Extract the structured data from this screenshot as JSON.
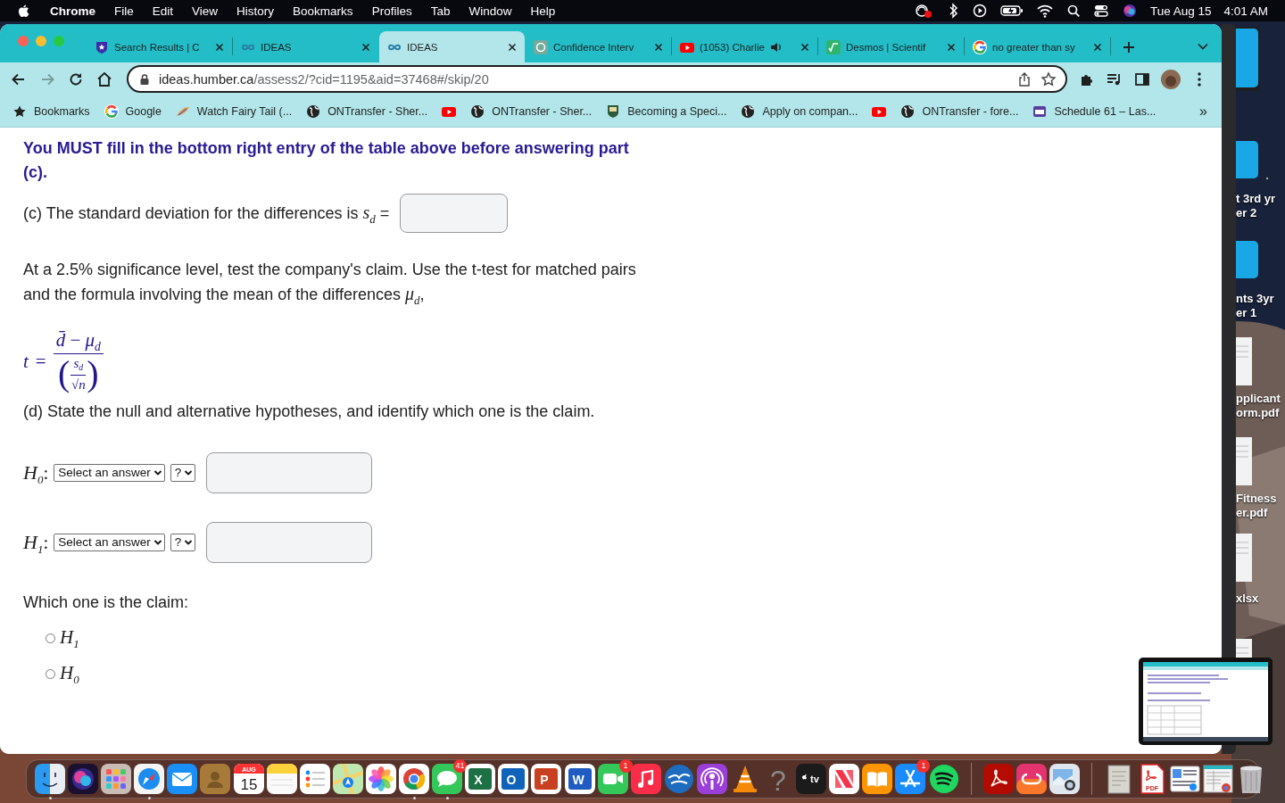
{
  "menu_bar": {
    "app": "Chrome",
    "items": [
      "File",
      "Edit",
      "View",
      "History",
      "Bookmarks",
      "Profiles",
      "Tab",
      "Window",
      "Help"
    ],
    "date": "Tue Aug 15",
    "time": "4:01 AM"
  },
  "browser": {
    "tabs": [
      {
        "title": "Search Results | C",
        "kind": "shield",
        "selected": false,
        "audio": false
      },
      {
        "title": "IDEAS",
        "kind": "infinity",
        "selected": false,
        "audio": false
      },
      {
        "title": "IDEAS",
        "kind": "infinity",
        "selected": true,
        "audio": false
      },
      {
        "title": "Confidence Interv",
        "kind": "knot",
        "selected": false,
        "audio": false
      },
      {
        "title": "(1053) Charlie",
        "kind": "play",
        "selected": false,
        "audio": true
      },
      {
        "title": "Desmos | Scientif",
        "kind": "root",
        "selected": false,
        "audio": false
      },
      {
        "title": "no greater than sy",
        "kind": "ring",
        "selected": false,
        "audio": false
      }
    ],
    "forward_disabled": true,
    "address": {
      "host": "ideas.humber.ca",
      "path": "/assess2/?cid=1195&aid=37468#/skip/20"
    },
    "bookmarks": [
      {
        "title": "Bookmarks",
        "kind": "star"
      },
      {
        "title": "Google",
        "kind": "ring"
      },
      {
        "title": "Watch Fairy Tail (...",
        "kind": "feather"
      },
      {
        "title": "ONTransfer - Sher...",
        "kind": "globe"
      },
      {
        "kind": "play"
      },
      {
        "title": "ONTransfer - Sher...",
        "kind": "globe"
      },
      {
        "title": "Becoming a Speci...",
        "kind": "crest"
      },
      {
        "title": "Apply on compan...",
        "kind": "globe"
      },
      {
        "kind": "play"
      },
      {
        "title": "ONTransfer - fore...",
        "kind": "globe"
      },
      {
        "title": "Schedule 61 – Las...",
        "kind": "badge"
      }
    ],
    "bookmarks_overflow": "»"
  },
  "page": {
    "notice": "You MUST fill in the bottom right entry of the table above before answering part (c).",
    "part_c": "(c) The standard deviation for the differences is *s*$_{d}$ =",
    "paragraph": "At a 2.5% significance level, test the company's claim. Use the t-test for matched pairs and the formula involving the mean of the differences *μ*$_{d}$,",
    "formula": {
      "lhs": "t",
      "equals": "=",
      "numerator": "*d̄* − *μ*$_{d}$",
      "open_paren": "(",
      "close_paren": ")",
      "inner_numerator": "*s*$_{d}$",
      "inner_denominator": "√*n*"
    },
    "part_d": "(d) State the null and alternative hypotheses, and identify which one is the claim.",
    "hypotheses": [
      {
        "label": "*H*$_{0}$:",
        "answer": "Select an answer",
        "operator": "?"
      },
      {
        "label": "*H*$_{1}$:",
        "answer": "Select an answer",
        "operator": "?"
      }
    ],
    "claim_question": "Which one is the claim:",
    "claim_options": [
      {
        "label": "*H*$_{1}$",
        "selected": false
      },
      {
        "label": "*H*$_{0}$",
        "selected": false
      }
    ]
  },
  "desktop": [
    {
      "kind": "folder"
    },
    {
      "kind": "folder",
      "label": "t 3rd yr\ner 2"
    },
    {
      "kind": "folder",
      "label": "nts 3yr\ner 1"
    },
    {
      "kind": "document",
      "label": "pplicant\norm.pdf"
    },
    {
      "kind": "document",
      "label": "Fitness\ner.pdf"
    },
    {
      "kind": "document",
      "label": "xlsx"
    },
    {
      "kind": "document"
    }
  ],
  "dock": [
    {
      "kind": "face",
      "running": true
    },
    {
      "kind": "orb"
    },
    {
      "kind": "grid"
    },
    {
      "kind": "compass",
      "running": true
    },
    {
      "kind": "envelope"
    },
    {
      "kind": "contact-card"
    },
    {
      "kind": "calendar",
      "month": "AUG",
      "day": "15"
    },
    {
      "kind": "notepad"
    },
    {
      "kind": "checklist"
    },
    {
      "kind": "map"
    },
    {
      "kind": "flower"
    },
    {
      "kind": "wheel",
      "running": true
    },
    {
      "kind": "speech-bubble",
      "running": true,
      "badge": "41"
    },
    {
      "kind": "letter-tile",
      "glyph": "X",
      "color": "#1d7044"
    },
    {
      "kind": "letter-tile",
      "glyph": "O",
      "color": "#0f63b8"
    },
    {
      "kind": "letter-tile",
      "glyph": "P",
      "color": "#c8401f"
    },
    {
      "kind": "letter-tile",
      "glyph": "W",
      "color": "#1f5bc0"
    },
    {
      "kind": "video-camera",
      "badge": "1"
    },
    {
      "kind": "music-note"
    },
    {
      "kind": "birds"
    },
    {
      "kind": "podcast"
    },
    {
      "kind": "cone"
    },
    {
      "kind": "symbol",
      "glyph": "?"
    },
    {
      "kind": "tv-tile",
      "glyph": "tv"
    },
    {
      "kind": "news"
    },
    {
      "kind": "book"
    },
    {
      "kind": "app-store",
      "badge": "1"
    },
    {
      "kind": "sound-waves"
    },
    {
      "kind": "divider"
    },
    {
      "kind": "swirl"
    },
    {
      "kind": "loops"
    },
    {
      "kind": "photo-viewer"
    },
    {
      "kind": "divider"
    },
    {
      "kind": "paper-stack"
    },
    {
      "kind": "pdf-file",
      "glyph": "PDF"
    },
    {
      "kind": "screenshot"
    },
    {
      "kind": "screenshot-stack"
    },
    {
      "kind": "trash-can"
    }
  ]
}
